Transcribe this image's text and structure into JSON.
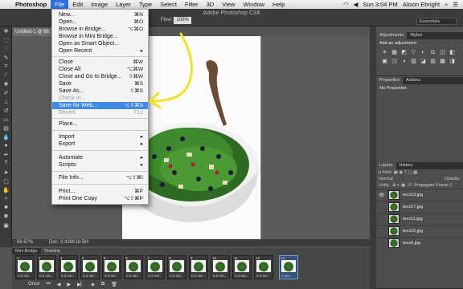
{
  "menubar": {
    "apple": "",
    "items": [
      "Photoshop",
      "File",
      "Edit",
      "Image",
      "Layer",
      "Type",
      "Select",
      "Filter",
      "3D",
      "View",
      "Window",
      "Help"
    ],
    "clock": "Sun 3:04 PM",
    "user": "Alison Ebright"
  },
  "window_title": "Adobe Photoshop CS6",
  "options": {
    "flow_label": "Flow:",
    "flow_value": "100%",
    "workspace": "Essentials"
  },
  "doc_tab": "Untitled-1 @ 66.",
  "file_menu": [
    {
      "label": "New...",
      "sc": "⌘N"
    },
    {
      "label": "Open...",
      "sc": "⌘O"
    },
    {
      "label": "Browse in Bridge...",
      "sc": "⌥⌘O"
    },
    {
      "label": "Browse in Mini Bridge...",
      "sc": ""
    },
    {
      "label": "Open as Smart Object...",
      "sc": ""
    },
    {
      "label": "Open Recent",
      "sc": "▸"
    },
    {
      "label": "Close",
      "sc": "⌘W"
    },
    {
      "label": "Close All",
      "sc": "⌥⌘W"
    },
    {
      "label": "Close and Go to Bridge...",
      "sc": "⇧⌘W"
    },
    {
      "label": "Save",
      "sc": "⌘S"
    },
    {
      "label": "Save As...",
      "sc": "⇧⌘S"
    },
    {
      "label": "Check In...",
      "sc": ""
    },
    {
      "label": "Save for Web...",
      "sc": "⌥⇧⌘S"
    },
    {
      "label": "Revert",
      "sc": "F12"
    },
    {
      "label": "Place...",
      "sc": ""
    },
    {
      "label": "Import",
      "sc": "▸"
    },
    {
      "label": "Export",
      "sc": "▸"
    },
    {
      "label": "Automate",
      "sc": "▸"
    },
    {
      "label": "Scripts",
      "sc": "▸"
    },
    {
      "label": "File Info...",
      "sc": "⌥⇧⌘I"
    },
    {
      "label": "Print...",
      "sc": "⌘P"
    },
    {
      "label": "Print One Copy",
      "sc": "⌥⇧⌘P"
    }
  ],
  "status": {
    "zoom": "66.67%",
    "doc": "Doc: 3.42M/18.5M"
  },
  "panels": {
    "adjustments_tab": "Adjustments",
    "styles_tab": "Styles",
    "add_adjustment": "Add an adjustment",
    "adj_icons": [
      "☀",
      "▦",
      "◩",
      "▽",
      "◐",
      "⚖",
      "◫",
      "◧",
      "▣",
      "◳",
      "◑",
      "▨",
      "◪",
      "▥",
      "▩",
      "◨"
    ],
    "properties_tab": "Properties",
    "actions_tab": "Actions",
    "no_properties": "No Properties",
    "layers_tab": "Layers",
    "history_tab": "History",
    "kind": "ρ Kind",
    "blend": "Normal",
    "opacity": "Opacity:",
    "unify": "Unify:",
    "propagate": "Propagate Frame 1",
    "layers": [
      "tecx13.jpg",
      "tecx17.jpg",
      "tecx11.jpg",
      "tecx10.jpg",
      "tecx9.jpg"
    ]
  },
  "timeline": {
    "tabs": [
      "Mini Bridge",
      "Timeline"
    ],
    "frame_time": "0.3 sec.",
    "selected_time": "2 sec.",
    "loop": "Once"
  }
}
